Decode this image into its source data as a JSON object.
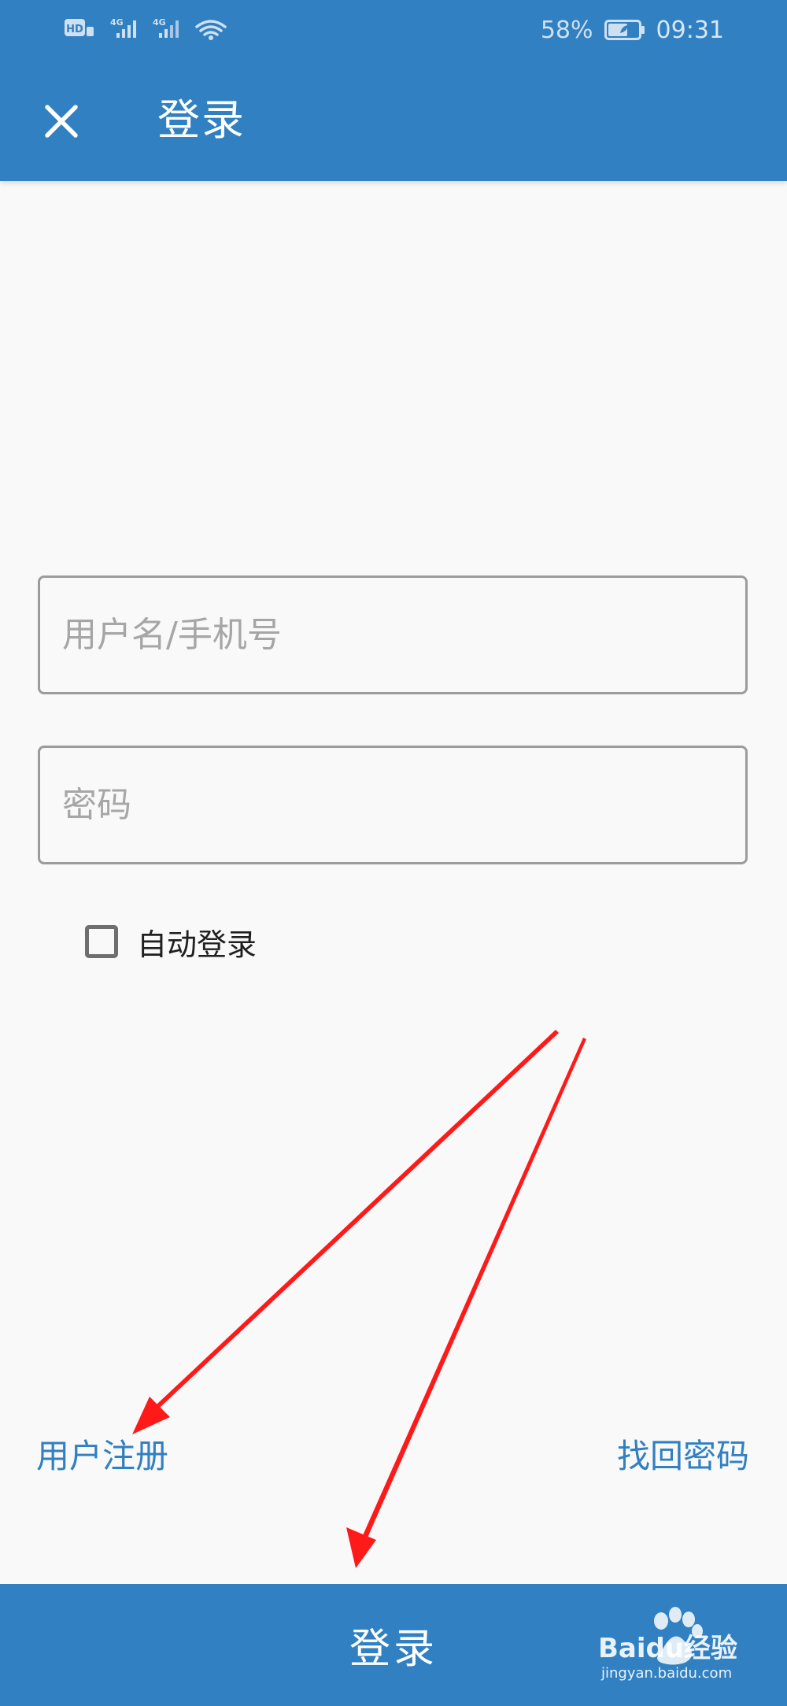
{
  "status_bar": {
    "battery_percent": "58%",
    "time": "09:31",
    "network_badges": [
      "HD",
      "4G",
      "4G"
    ]
  },
  "app_bar": {
    "title": "登录",
    "close_icon": "close-icon"
  },
  "form": {
    "username": {
      "placeholder": "用户名/手机号",
      "value": ""
    },
    "password": {
      "placeholder": "密码",
      "value": ""
    },
    "auto_login": {
      "label": "自动登录",
      "checked": false
    }
  },
  "links": {
    "register": "用户注册",
    "recover_password": "找回密码"
  },
  "login_button": {
    "label": "登录"
  },
  "watermark": {
    "brand": "Baidu经验",
    "url": "jingyan.baidu.com"
  },
  "colors": {
    "primary": "#3080c2",
    "background": "#f9f9f9",
    "field_border": "#9c9c9c",
    "placeholder": "#a6a6a6",
    "annotation_arrow": "#ff1a1a"
  }
}
